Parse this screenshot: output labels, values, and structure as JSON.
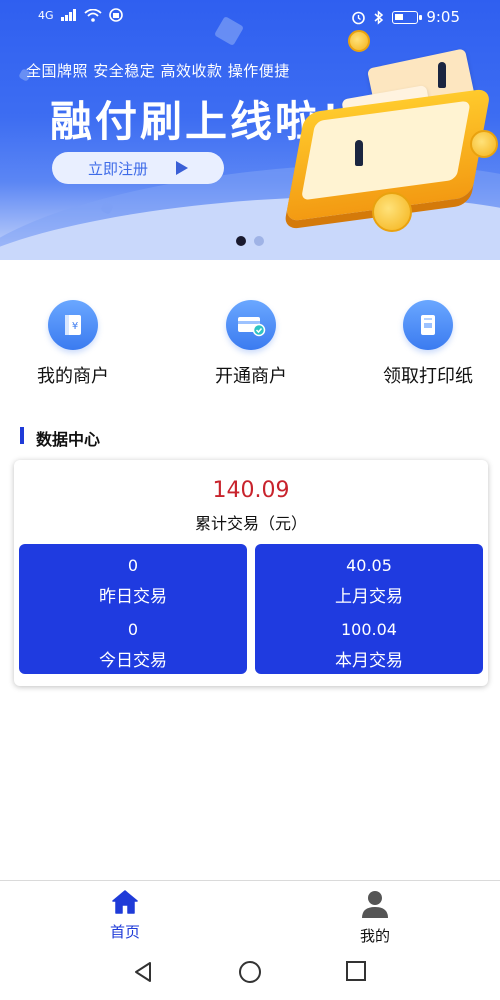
{
  "status_bar": {
    "network": "4G",
    "time": "9:05"
  },
  "banner": {
    "tagline": "全国牌照 安全稳定 高效收款 操作便捷",
    "headline": "融付刷上线啦！",
    "register_button": "立即注册",
    "slide_count": 2,
    "active_slide": 0
  },
  "quick_actions": [
    {
      "label": "我的商户",
      "icon": "ledger-icon"
    },
    {
      "label": "开通商户",
      "icon": "card-check-icon"
    },
    {
      "label": "领取打印纸",
      "icon": "printer-paper-icon"
    }
  ],
  "data_center": {
    "title": "数据中心",
    "total": {
      "value": "140.09",
      "label": "累计交易（元）"
    },
    "stats": {
      "yesterday": {
        "value": "0",
        "label": "昨日交易"
      },
      "last_month": {
        "value": "40.05",
        "label": "上月交易"
      },
      "today": {
        "value": "0",
        "label": "今日交易"
      },
      "this_month": {
        "value": "100.04",
        "label": "本月交易"
      }
    }
  },
  "tab_bar": {
    "home": "首页",
    "mine": "我的",
    "active": "home"
  },
  "colors": {
    "brand_blue": "#1f3be0",
    "accent_red": "#c8232c",
    "banner_blue": "#3d6df2"
  }
}
